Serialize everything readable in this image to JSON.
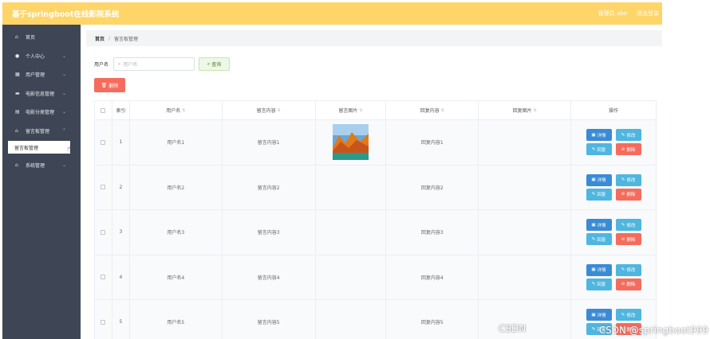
{
  "header": {
    "title": "基于springboot在线影院系统",
    "user": "管理员 abo",
    "logout": "退出登录"
  },
  "sidebar": {
    "items": [
      {
        "icon": "⌂",
        "label": "首页",
        "arrow": ""
      },
      {
        "icon": "●",
        "label": "个人中心",
        "arrow": "⌄"
      },
      {
        "icon": "▦",
        "label": "用户管理",
        "arrow": "⌄"
      },
      {
        "icon": "▬",
        "label": "电影信息管理",
        "arrow": "⌄"
      },
      {
        "icon": "▤",
        "label": "电影分类管理",
        "arrow": "⌄"
      },
      {
        "icon": "⌂",
        "label": "留言板管理",
        "arrow": "⌃"
      }
    ],
    "sub_item": "留言板管理",
    "system": {
      "icon": "⌂",
      "label": "系统管理",
      "arrow": "⌄"
    }
  },
  "breadcrumb": {
    "home": "首页",
    "sep": "/",
    "current": "留言板管理"
  },
  "search": {
    "label": "用户名",
    "placeholder": "用户名",
    "query_label": "查询",
    "delete_label": "删除"
  },
  "table": {
    "headers": [
      "索引",
      "用户名",
      "留言内容",
      "留言图片",
      "回复内容",
      "回复图片",
      "操作"
    ],
    "rows": [
      {
        "index": "1",
        "username": "用户名1",
        "content": "留言内容1",
        "reply": "回复内容1",
        "has_image": true
      },
      {
        "index": "2",
        "username": "用户名2",
        "content": "留言内容2",
        "reply": "回复内容2",
        "has_image": false
      },
      {
        "index": "3",
        "username": "用户名3",
        "content": "留言内容3",
        "reply": "回复内容3",
        "has_image": false
      },
      {
        "index": "4",
        "username": "用户名4",
        "content": "留言内容4",
        "reply": "回复内容4",
        "has_image": false
      },
      {
        "index": "5",
        "username": "用户名5",
        "content": "留言内容5",
        "reply": "回复内容5",
        "has_image": false
      }
    ],
    "ops": {
      "detail": "详情",
      "edit": "修改",
      "reply": "回复",
      "delete": "删除"
    }
  },
  "watermark": "CSDN @springboot999",
  "colors": {
    "header": "#ffd56a",
    "sidebar": "#3e4656",
    "danger": "#f56c5d",
    "primary": "#3a8bd6",
    "info": "#4fb6e0"
  }
}
